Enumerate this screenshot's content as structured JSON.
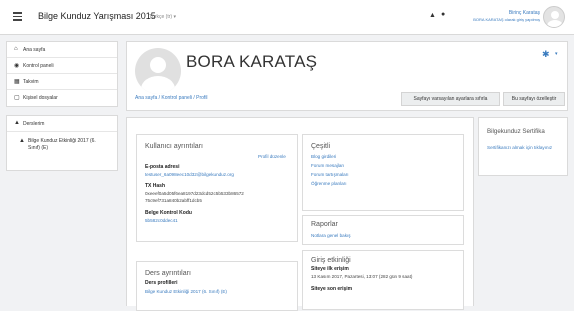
{
  "navbar": {
    "site_name": "Bilge Kunduz Yarışması 2015",
    "language": "Türkçe (tr) ▾",
    "user_name": "Birinç Karataş",
    "logged_in_as": "BORA KARATAŞ olarak giriş yapılmış"
  },
  "drawer": {
    "items": [
      {
        "icon": "home-icon",
        "glyph": "⌂",
        "label": "Ana sayfa"
      },
      {
        "icon": "dashboard-icon",
        "glyph": "◉",
        "label": "Kontrol paneli"
      },
      {
        "icon": "calendar-icon",
        "glyph": "▦",
        "label": "Takvim"
      },
      {
        "icon": "file-icon",
        "glyph": "▢",
        "label": "Kişisel dosyalar"
      },
      {
        "icon": "courses-icon",
        "glyph": "▲",
        "label": "Derslerim"
      }
    ],
    "course": {
      "icon": "course-icon",
      "glyph": "▲",
      "label": "Bilge Kunduz Etkinliği 2017 (6. Sınıf) (E)"
    }
  },
  "header": {
    "name": "BORA KARATAŞ",
    "breadcrumb": "Ana sayfa / Kontrol paneli / Profil",
    "reset_button": "Sayfayı varsayılan ayarlara sıfırla",
    "customize_button": "Bu sayfayı özelleştir"
  },
  "user_details": {
    "title": "Kullanıcı ayrıntıları",
    "edit_link": "Profil düzenle",
    "email_label": "E-posta adresi",
    "email_value": "testuser_6a098eec10d32@bilgekunduz.org",
    "txhash_label": "TX Hash",
    "txhash_line1": "0xeeef0a5d05f6ea8197d23dcd52c5b533b86572",
    "txhash_line2": "75c9ef731a840b2abff1dcb5",
    "control_label": "Belge Kontrol Kodu",
    "control_value": "5b582c0ddec41"
  },
  "course_details": {
    "title": "Ders ayrıntıları",
    "profiles_label": "Ders profilleri",
    "course_link": "Bilge Kunduz Etkinliği 2017 (6. Sınıf) (E)"
  },
  "misc": {
    "title": "Çeşitli",
    "links": [
      "Blog girdileri",
      "Forum mesajları",
      "Forum tartışmaları",
      "Öğrenme planları"
    ]
  },
  "reports": {
    "title": "Raporlar",
    "link": "Notlara genel bakış"
  },
  "login_activity": {
    "title": "Giriş etkinliği",
    "first_access_label": "Siteye ilk erişim",
    "first_access_value": "13 Kasım 2017, Pazartesi, 13:07  (282 gün 9 saat)",
    "last_access_label": "Siteye son erişim"
  },
  "certificate": {
    "title": "Bilgekunduz Sertifika",
    "link": "Sertifikanızı almak için tıklayınız"
  }
}
